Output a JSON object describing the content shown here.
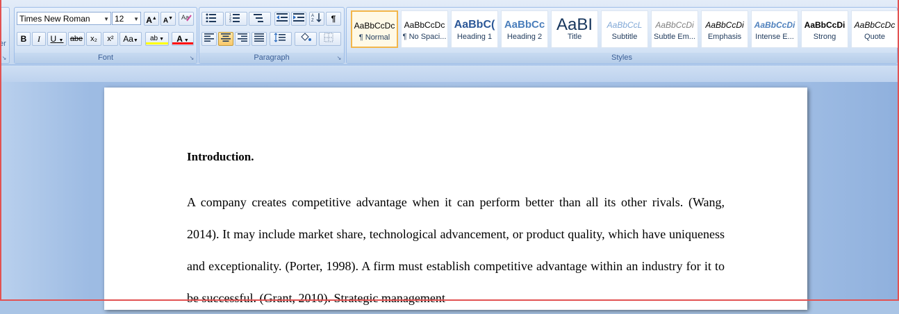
{
  "ribbon": {
    "clipboard_stub": "er",
    "font_group": {
      "label": "Font",
      "font_name": "Times New Roman",
      "font_size": "12",
      "grow_font": "A",
      "shrink_font": "A",
      "clear_format_icon": "clear-formatting-icon",
      "bold": "B",
      "italic": "I",
      "underline": "U",
      "strikethrough": "abe",
      "subscript": "x₂",
      "superscript": "x²",
      "change_case": "Aa",
      "highlight": "ab",
      "font_color": "A",
      "highlight_color": "#ffff00",
      "font_color_value": "#ff0000"
    },
    "paragraph_group": {
      "label": "Paragraph",
      "show_marks": "¶"
    },
    "styles_group": {
      "label": "Styles",
      "styles": [
        {
          "sample": "AaBbCcDc",
          "name": "¶ Normal"
        },
        {
          "sample": "AaBbCcDc",
          "name": "¶ No Spaci..."
        },
        {
          "sample": "AaBbC(",
          "name": "Heading 1"
        },
        {
          "sample": "AaBbCc",
          "name": "Heading 2"
        },
        {
          "sample": "AaBI",
          "name": "Title"
        },
        {
          "sample": "AaBbCcL",
          "name": "Subtitle"
        },
        {
          "sample": "AaBbCcDi",
          "name": "Subtle Em..."
        },
        {
          "sample": "AaBbCcDi",
          "name": "Emphasis"
        },
        {
          "sample": "AaBbCcDi",
          "name": "Intense E..."
        },
        {
          "sample": "AaBbCcDi",
          "name": "Strong"
        },
        {
          "sample": "AaBbCcDc",
          "name": "Quote"
        }
      ]
    }
  },
  "document": {
    "heading": "Introduction.",
    "body": "A company creates competitive advantage when it can perform better than all its other rivals. (Wang, 2014). It may include market share, technological advancement, or product quality, which have uniqueness and exceptionality. (Porter, 1998). A firm must establish competitive advantage within an industry for it to be successful. (Grant, 2010). Strategic management"
  }
}
